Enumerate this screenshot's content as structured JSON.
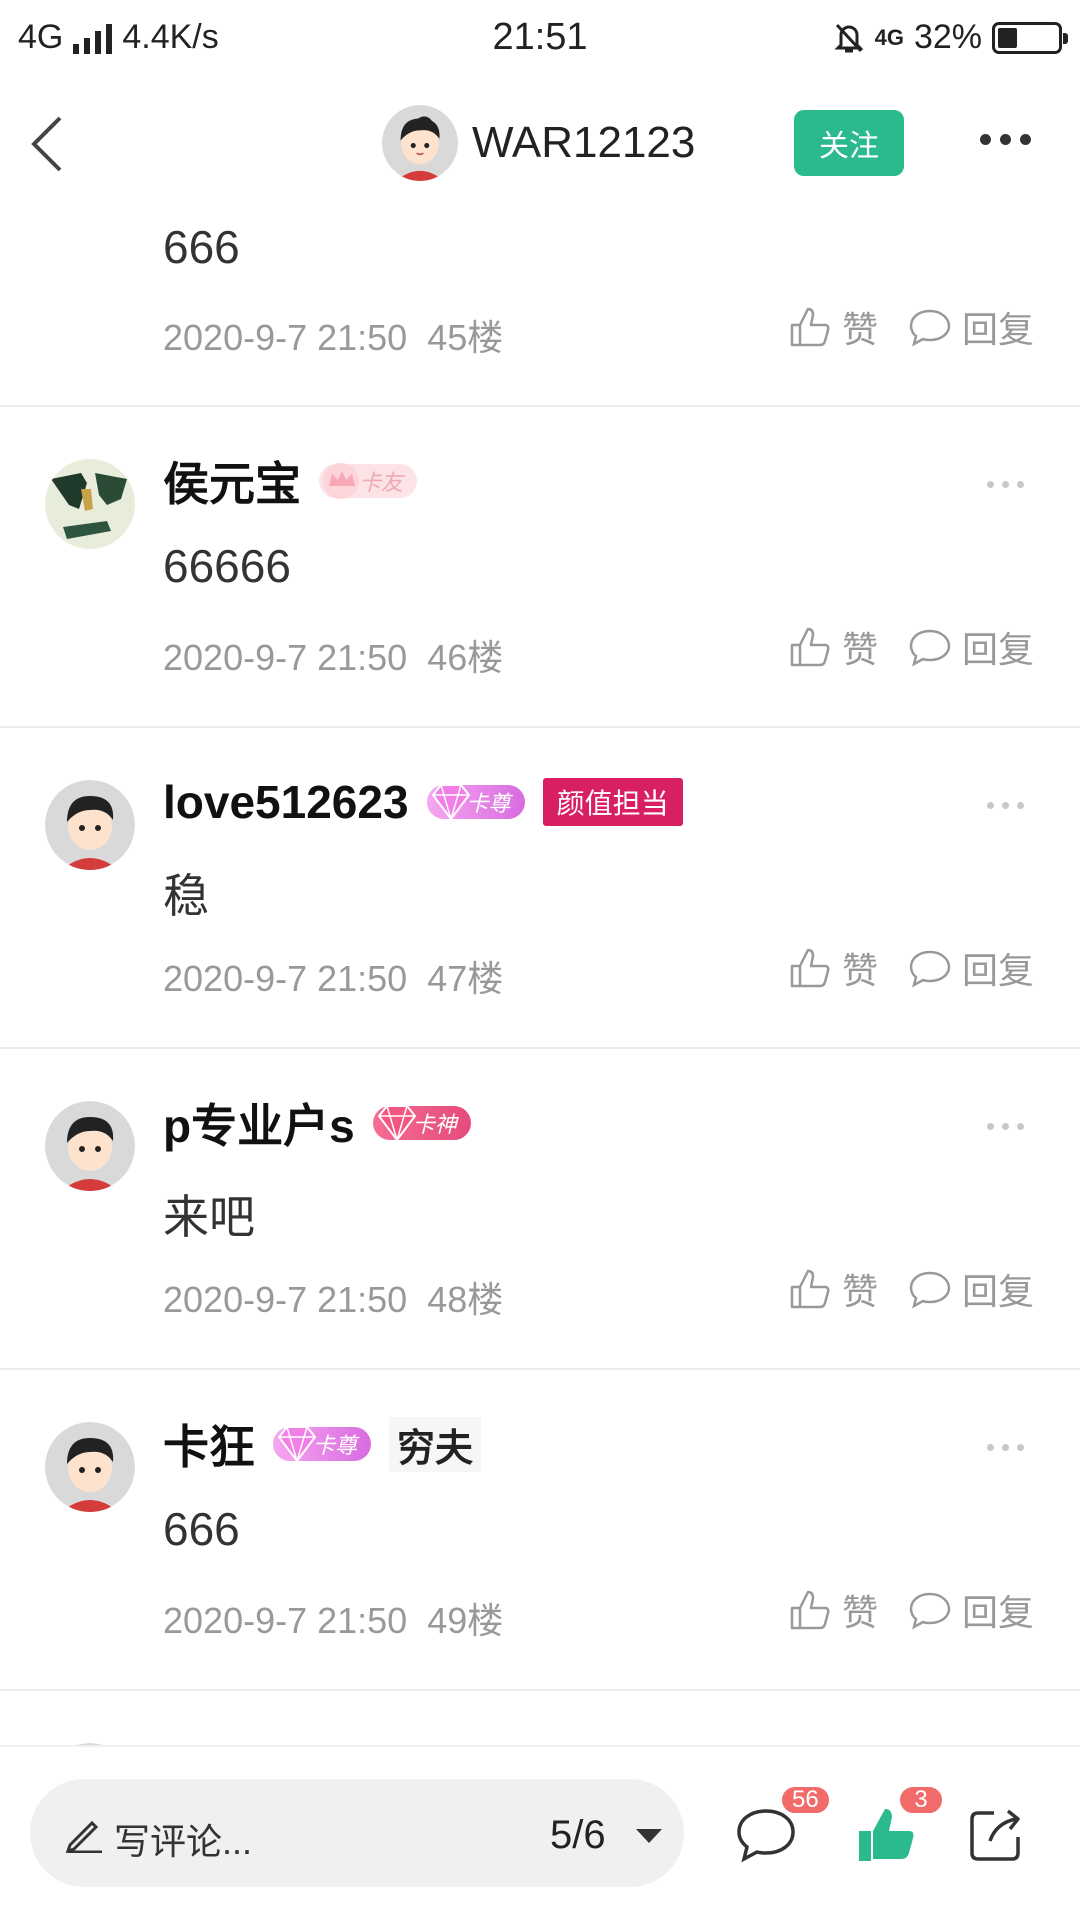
{
  "status_bar": {
    "network": "4G",
    "speed": "4.4K/s",
    "time": "21:51",
    "net2": "4G",
    "battery": "32%",
    "battery_level": 0.32
  },
  "header": {
    "username": "WAR12123",
    "follow_label": "关注"
  },
  "comments": [
    {
      "content": "666",
      "time": "2020-9-7 21:50",
      "floor": "45楼",
      "like_label": "赞",
      "reply_label": "回复"
    },
    {
      "username": "侯元宝",
      "badge": "卡友",
      "badge_type": "kayou",
      "avatar": "weapon-avatar",
      "content": "66666",
      "time": "2020-9-7 21:50",
      "floor": "46楼",
      "like_label": "赞",
      "reply_label": "回复"
    },
    {
      "username": "love512623",
      "badge": "卡尊",
      "badge_type": "kazun",
      "tag": "颜值担当",
      "avatar": "default-boy-avatar",
      "content": "稳",
      "time": "2020-9-7 21:50",
      "floor": "47楼",
      "like_label": "赞",
      "reply_label": "回复"
    },
    {
      "username": "p专业户s",
      "badge": "卡神",
      "badge_type": "kashen",
      "avatar": "default-boy-avatar",
      "content": "来吧",
      "time": "2020-9-7 21:50",
      "floor": "48楼",
      "like_label": "赞",
      "reply_label": "回复"
    },
    {
      "username": "卡狂",
      "badge": "卡尊",
      "badge_type": "kazun",
      "tag_plain": "穷夫",
      "avatar": "default-boy-avatar",
      "content": "666",
      "time": "2020-9-7 21:50",
      "floor": "49楼",
      "like_label": "赞",
      "reply_label": "回复"
    }
  ],
  "bottom_bar": {
    "write_placeholder": "写评论...",
    "pager": "5/6",
    "comment_count": "56",
    "like_count": "3"
  },
  "colors": {
    "accent_green": "#2bb98e",
    "count_red": "#f26b6b",
    "tag_pink": "#d81f63"
  }
}
